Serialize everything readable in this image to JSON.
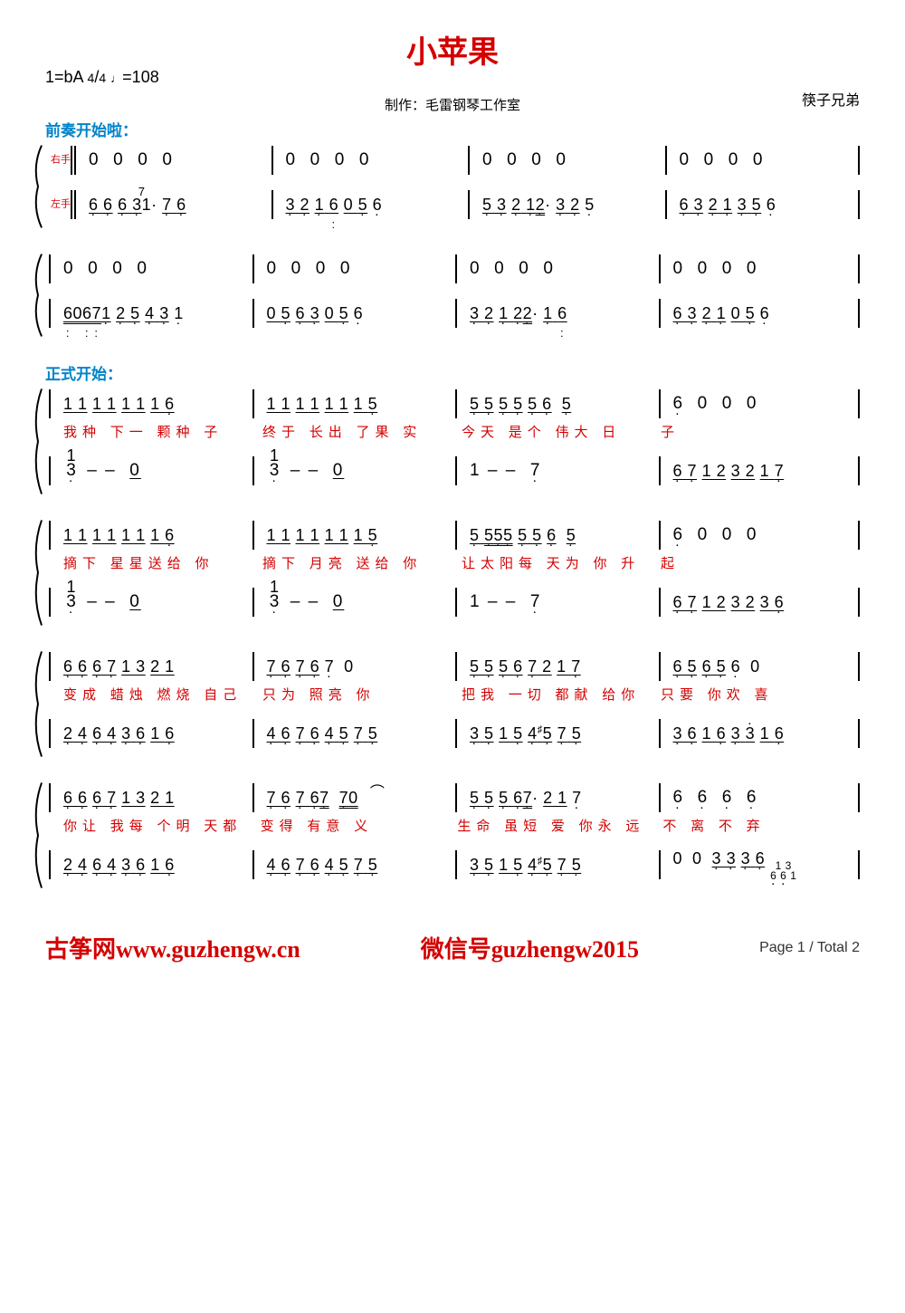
{
  "header": {
    "title": "小苹果",
    "tempo": "1=bA 4/4 ♩=108",
    "producer": "制作：毛雷钢琴工作室",
    "composer": "筷子兄弟"
  },
  "sections": {
    "intro_label": "前奏开始啦：",
    "verse_label": "正式开始："
  },
  "clefs": {
    "right": "右手",
    "left": "左手"
  },
  "systems": [
    {
      "right": [
        "0 0 0 0",
        "0 0 0 0",
        "0 0 0 0",
        "0 0 0 0"
      ],
      "left": [
        "6̣ 6̣ 6̣ 3̣1· 7̣ 6̣",
        "3̣ 2̣ 1̣ 6̤ 0 5̣ 6̣",
        "5̣ 3̣ 2̣ 1̣2· 3̣ 2̣ 5̣",
        "6̣ 3̣ 2̣ 1̣ 3̣ 5̣ 6̣"
      ]
    },
    {
      "right": [
        "0 0 0 0",
        "0 0 0 0",
        "0 0 0 0",
        "0 0 0 0"
      ],
      "left": [
        "6̤0̣6̤7̤1̣ 2̣ 5̣ 4̣ 3̣ 1̣",
        "0 5̣ 6̣ 3̣ 0 5̣ 6̣",
        "3̣ 2̣ 1̣ 2̣2̣· 1̣ 6̤",
        "6̣ 3̣ 2̣ 1̣ 0 5̣ 6̣"
      ]
    },
    {
      "right": [
        "1 1 1 1 1 1 1 6̣",
        "1 1 1 1 1 1 1 5̣",
        "5̣ 5̣ 5̣ 5̣ 5̣ 6̣  5̣",
        "6̣ 0 0 0"
      ],
      "lyrics": [
        "我种 下一 颗种 子",
        "终于 长出 了果 实",
        "今天 是个 伟大  日",
        "子"
      ],
      "left": [
        "1/3̣ – – 0",
        "1/3̣ – – 0",
        "1 – – 7̣",
        "6̣ 7̣ 1 2 3 2 1 7̣"
      ]
    },
    {
      "right": [
        "1 1 1 1 1 1 1 6̣",
        "1 1 1 1 1 1 1 5̣",
        "5̣ 5̣5̣5̣ 5̣ 5̣ 6̣  5̣",
        "6̣ 0 0 0"
      ],
      "lyrics": [
        "摘下 星星送给 你",
        "摘下 月亮 送给 你",
        "让太阳每 天为 你  升",
        "起"
      ],
      "left": [
        "1/3̣ – – 0",
        "1/3̣ – – 0",
        "1 – – 7̣",
        "6̣ 7̣ 1 2 3 2 3 6̣"
      ]
    },
    {
      "right": [
        "6̣ 6̣ 6̣ 7̣ 1 3 2 1",
        "7̣ 6̣ 7̣ 6̣ 7̣ 0",
        "5̣ 5̣ 5̣ 6̣ 7̣ 2 1 7̣",
        "6̣ 5̣ 6̣ 5̣ 6̣ 0"
      ],
      "lyrics": [
        "变成 蜡烛 燃烧 自己",
        "只为 照亮 你",
        "把我 一切 都献 给你",
        "只要 你欢 喜"
      ],
      "left": [
        "2̣ 4̣ 6̣ 4̣ 3̣ 6̣ 1 6̣",
        "4̣ 6̣ 7̣ 6̣ 4̣ 5̣ 7̣ 5̣",
        "3̣ 5̣ 1 5̣ 4̣♯5̣ 7̣ 5̣",
        "3̣ 6̣ 1 6̣ 3̣ 3̇ 1 6̣"
      ]
    },
    {
      "right": [
        "6̣ 6̣ 6̣ 7̣ 1 3 2 1",
        "7̣ 6̣ 7̣ 6̣7̣  7̣0",
        "5̣ 5̣ 5̣ 6̣7̣· 2 1 7̣",
        "6̣ 6̣ 6̣ 6̣"
      ],
      "lyrics": [
        "你让 我每 个明 天都",
        "变得 有意 义",
        "生命 虽短 爱 你永 远",
        "不 离 不 弃"
      ],
      "left": [
        "2̣ 4̣ 6̣ 4̣ 3̣ 6̣ 1 6̣",
        "4̣ 6̣ 7̣ 6̣ 4̣ 5̣ 7̣ 5̣",
        "3̣ 5̣ 1 5̣ 4̣♯5̣ 7̣ 5̣",
        "0 0 3̣3̣3̣6̣  (1 3 / 6̣ 6̣ 1 / 3̣ 3̣ 3̣ 6̣)"
      ]
    }
  ],
  "footer": {
    "brand": "古筝网www.guzhengw.cn",
    "wechat": "微信号guzhengw2015",
    "page": "Page 1 / Total 2"
  }
}
